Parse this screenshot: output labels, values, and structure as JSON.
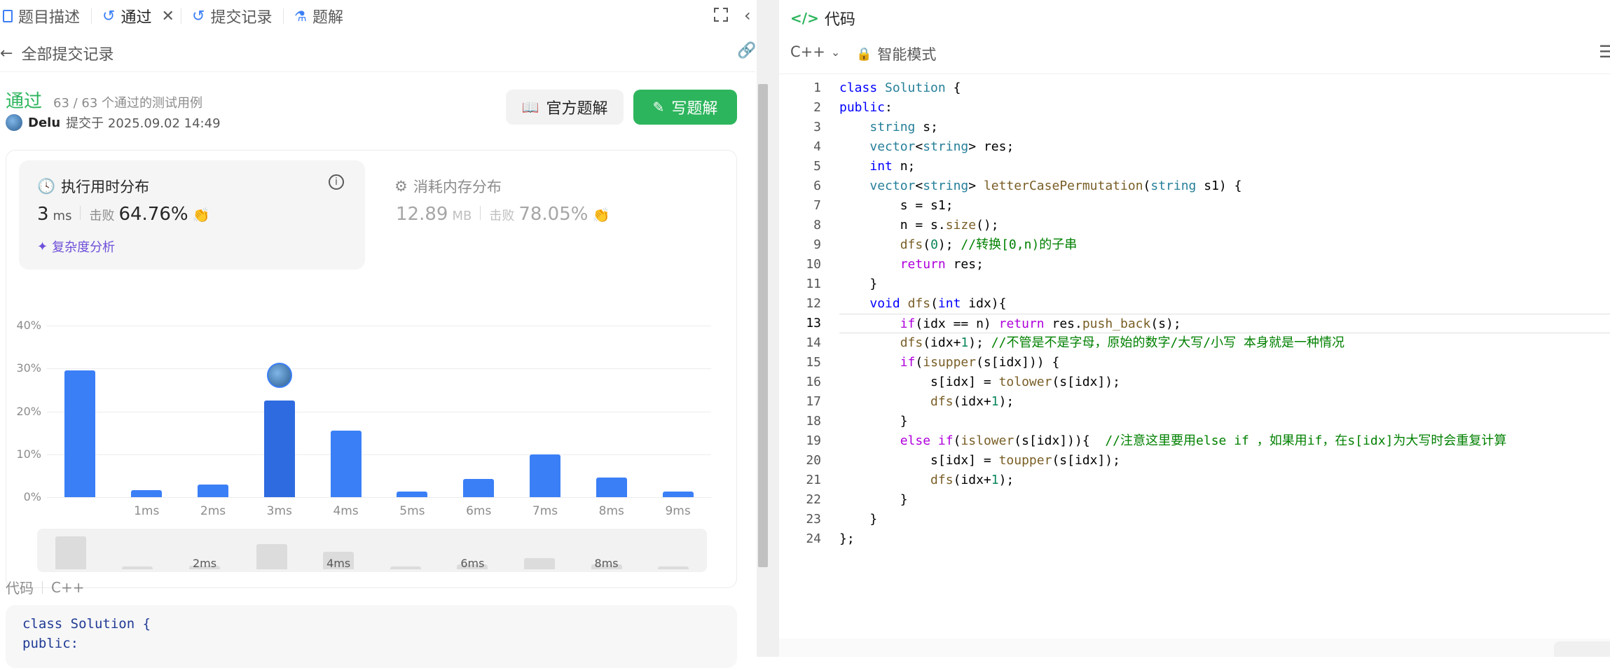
{
  "tabs": [
    {
      "label": "题目描述"
    },
    {
      "label": "通过"
    },
    {
      "label": "提交记录"
    },
    {
      "label": "题解"
    }
  ],
  "right_header": {
    "title": "代码",
    "language": "C++",
    "mode": "智能模式"
  },
  "submission": {
    "back_label": "全部提交记录",
    "status": "通过",
    "cases": "63 / 63 个通过的测试用例",
    "user": "Delu",
    "submitted": "提交于 2025.09.02 14:49",
    "official_btn": "官方题解",
    "write_btn": "写题解"
  },
  "runtime": {
    "title": "执行用时分布",
    "value": "3",
    "unit": "ms",
    "beat_label": "击败",
    "beat": "64.76%",
    "complexity": "复杂度分析"
  },
  "memory": {
    "title": "消耗内存分布",
    "value": "12.89",
    "unit": "MB",
    "beat_label": "击败",
    "beat": "78.05%"
  },
  "chart_data": {
    "type": "bar",
    "categories": [
      "",
      "1ms",
      "2ms",
      "3ms",
      "4ms",
      "5ms",
      "6ms",
      "7ms",
      "8ms",
      "9ms"
    ],
    "x_tick_labels": [
      "",
      "1ms",
      "2ms",
      "3ms",
      "4ms",
      "5ms",
      "6ms",
      "7ms",
      "8ms",
      "9ms"
    ],
    "values": [
      29.5,
      1.7,
      3.0,
      22.5,
      15.5,
      1.3,
      4.3,
      10.0,
      4.5,
      1.3
    ],
    "highlight_index": 3,
    "y_ticks": [
      "40%",
      "30%",
      "20%",
      "10%",
      "0%"
    ],
    "ylim": [
      0,
      40
    ],
    "grid": true,
    "mini_labels": [
      "2ms",
      "4ms",
      "6ms",
      "8ms"
    ],
    "colors": {
      "bar": "#3b7ff7",
      "highlight": "#2f6be0"
    }
  },
  "code_section": {
    "label": "代码",
    "lang": "C++",
    "preview": [
      "class Solution {",
      "public:"
    ]
  },
  "editor": {
    "lines": [
      "class Solution {",
      "public:",
      "    string s;",
      "    vector<string> res;",
      "    int n;",
      "    vector<string> letterCasePermutation(string s1) {",
      "        s = s1;",
      "        n = s.size();",
      "        dfs(0); //转换[0,n)的子串",
      "        return res;",
      "    }",
      "    void dfs(int idx){",
      "        if(idx == n) return res.push_back(s);",
      "        dfs(idx+1); //不管是不是字母，原始的数字/大写/小写 本身就是一种情况",
      "        if(isupper(s[idx])) {",
      "            s[idx] = tolower(s[idx]);",
      "            dfs(idx+1);",
      "        }",
      "        else if(islower(s[idx])){  //注意这里要用else if ，如果用if，在s[idx]为大写时会重复计算",
      "            s[idx] = toupper(s[idx]);",
      "            dfs(idx+1);",
      "        }",
      "    }",
      "};"
    ],
    "active_line": 13
  }
}
